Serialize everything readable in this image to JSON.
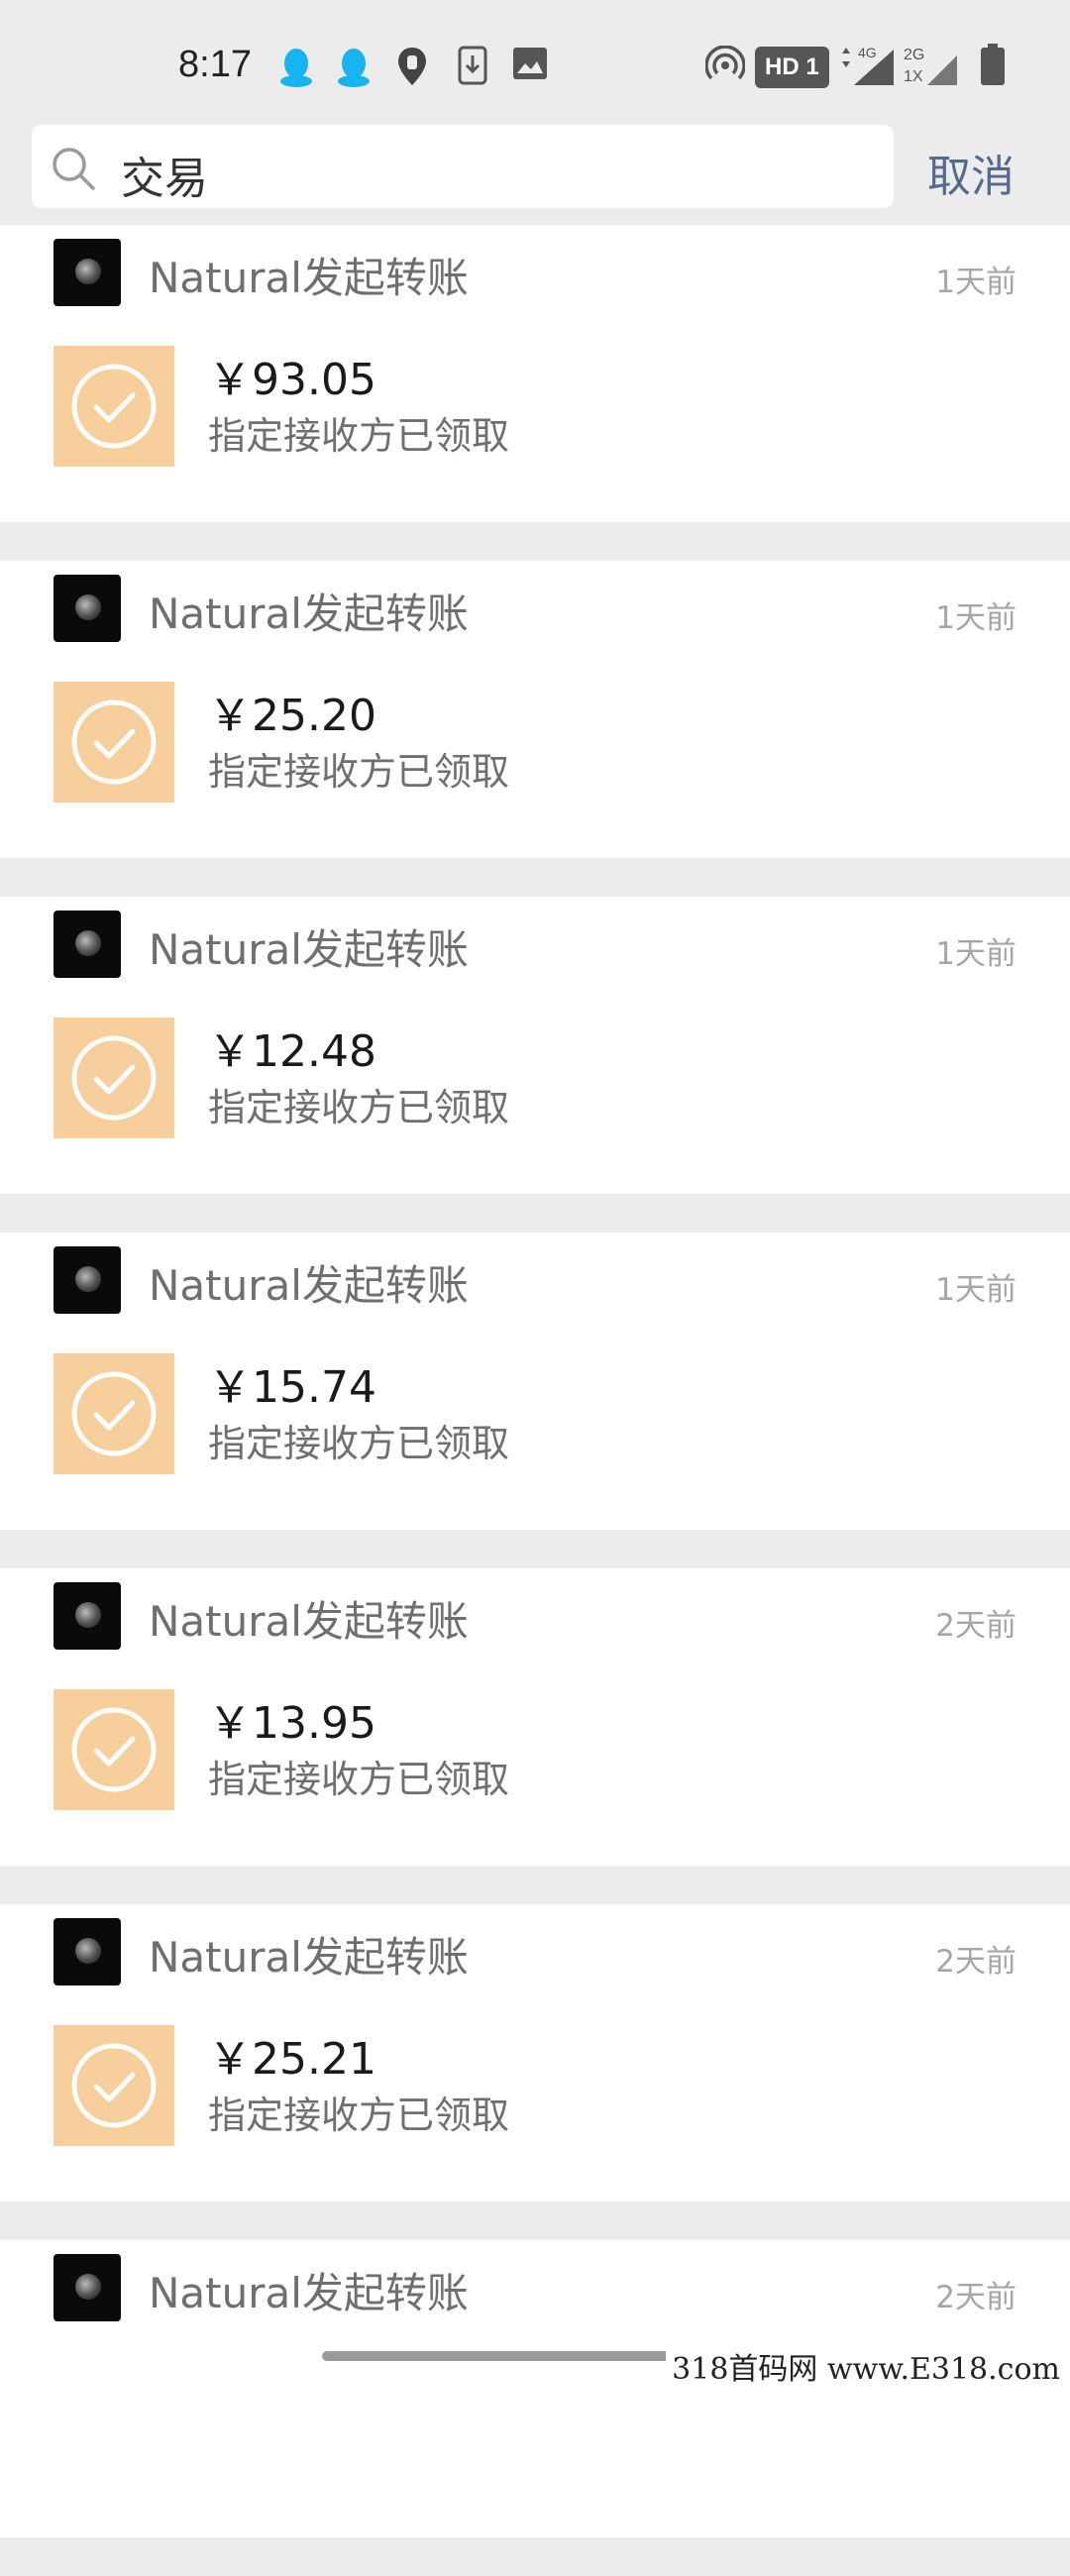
{
  "status_bar": {
    "time": "8:17",
    "icons": [
      "qq-icon",
      "qq-icon",
      "location-icon",
      "download-icon",
      "image-icon",
      "hotspot-icon",
      "hd-badge",
      "signal-4g-icon",
      "signal-2g-icon",
      "battery-icon"
    ],
    "network_badge": "HD 1"
  },
  "search": {
    "query": "交易",
    "cancel_label": "取消"
  },
  "transactions": [
    {
      "title": "Natural发起转账",
      "time": "1天前",
      "amount": "￥93.05",
      "status": "指定接收方已领取"
    },
    {
      "title": "Natural发起转账",
      "time": "1天前",
      "amount": "￥25.20",
      "status": "指定接收方已领取"
    },
    {
      "title": "Natural发起转账",
      "time": "1天前",
      "amount": "￥12.48",
      "status": "指定接收方已领取"
    },
    {
      "title": "Natural发起转账",
      "time": "1天前",
      "amount": "￥15.74",
      "status": "指定接收方已领取"
    },
    {
      "title": "Natural发起转账",
      "time": "2天前",
      "amount": "￥13.95",
      "status": "指定接收方已领取"
    },
    {
      "title": "Natural发起转账",
      "time": "2天前",
      "amount": "￥25.21",
      "status": "指定接收方已领取"
    },
    {
      "title": "Natural发起转账",
      "time": "2天前",
      "amount": "",
      "status": ""
    }
  ],
  "watermark": "318首码网 www.E318.com",
  "colors": {
    "transfer_icon_bg": "#f6cf9c",
    "accent_text": "#556a8c",
    "card_bg": "#ffffff",
    "page_bg": "#ececec"
  }
}
